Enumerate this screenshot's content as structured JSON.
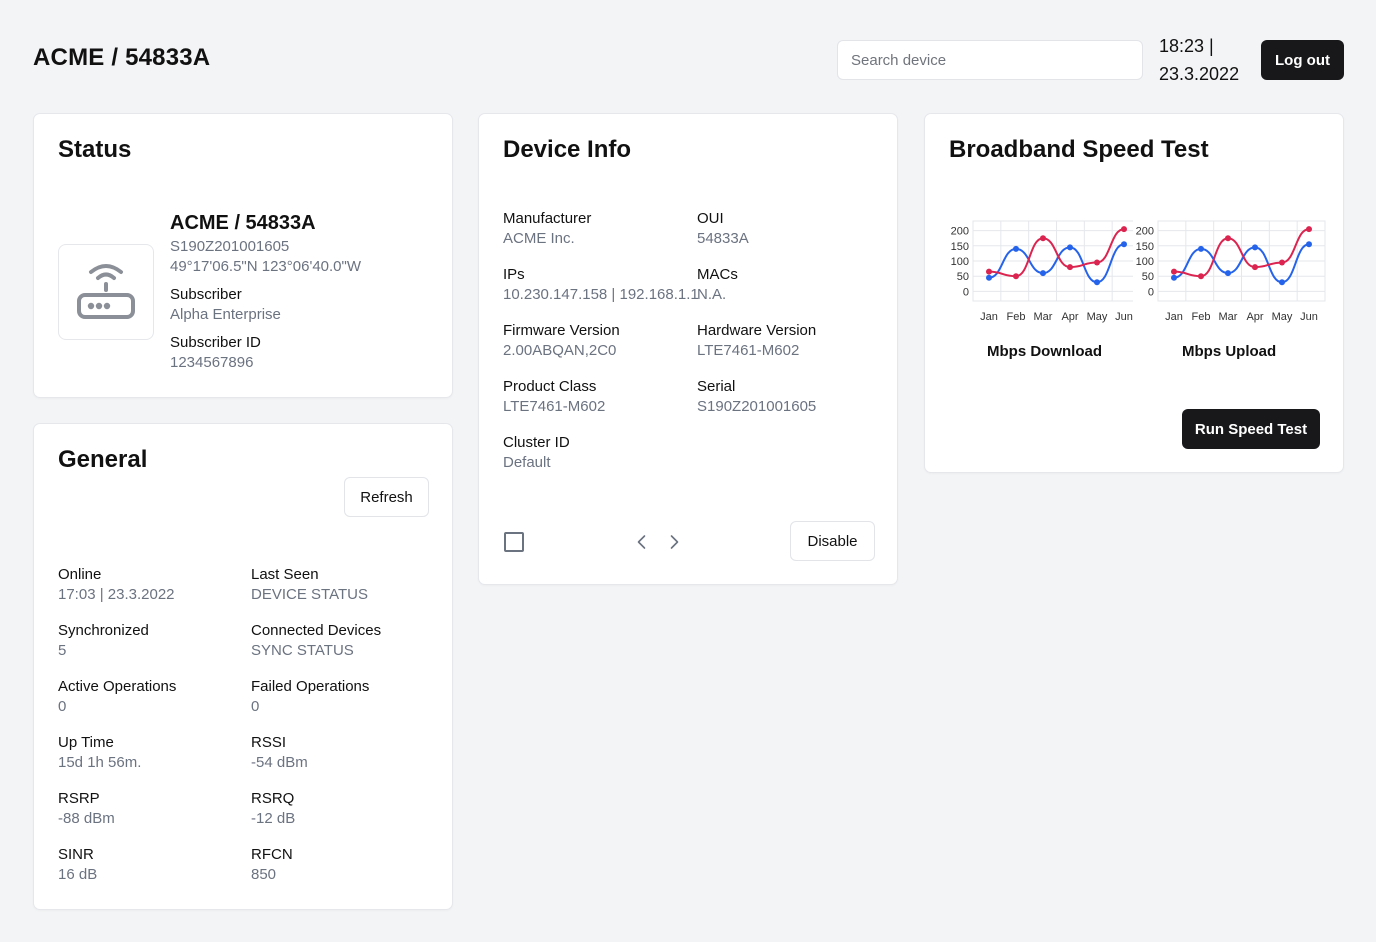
{
  "header": {
    "title": "ACME / 54833A",
    "search_placeholder": "Search device",
    "time": "18:23 |",
    "date": "23.3.2022",
    "logout_label": "Log out"
  },
  "status": {
    "title": "Status",
    "device_name": "ACME / 54833A",
    "serial": "S190Z201001605",
    "coordinates": "49°17'06.5\"N 123°06'40.0\"W",
    "subscriber_label": "Subscriber",
    "subscriber_value": "Alpha Enterprise",
    "subscriber_id_label": "Subscriber ID",
    "subscriber_id_value": "1234567896",
    "icon": "router-icon"
  },
  "general": {
    "title": "General",
    "refresh_label": "Refresh",
    "fields": [
      {
        "label": "Online",
        "value": "17:03 | 23.3.2022"
      },
      {
        "label": "Last Seen",
        "value": "DEVICE STATUS"
      },
      {
        "label": "Synchronized",
        "value": "5"
      },
      {
        "label": "Connected Devices",
        "value": "SYNC STATUS"
      },
      {
        "label": "Active Operations",
        "value": "0"
      },
      {
        "label": "Failed Operations",
        "value": "0"
      },
      {
        "label": "Up Time",
        "value": "15d 1h 56m."
      },
      {
        "label": "RSSI",
        "value": "-54 dBm"
      },
      {
        "label": "RSRP",
        "value": "-88 dBm"
      },
      {
        "label": "RSRQ",
        "value": "-12 dB"
      },
      {
        "label": "SINR",
        "value": "16 dB"
      },
      {
        "label": "RFCN",
        "value": "850"
      }
    ]
  },
  "device_info": {
    "title": "Device Info",
    "fields": [
      {
        "label": "Manufacturer",
        "value": "ACME Inc."
      },
      {
        "label": "OUI",
        "value": "54833A"
      },
      {
        "label": "IPs",
        "value": "10.230.147.158 | 192.168.1.1"
      },
      {
        "label": "MACs",
        "value": "N.A."
      },
      {
        "label": "Firmware Version",
        "value": "2.00ABQAN,2C0"
      },
      {
        "label": "Hardware Version",
        "value": "LTE7461-M602"
      },
      {
        "label": "Product Class",
        "value": "LTE7461-M602"
      },
      {
        "label": "Serial",
        "value": "S190Z201001605"
      },
      {
        "label": "Cluster ID",
        "value": "Default"
      }
    ],
    "disable_label": "Disable"
  },
  "speed_test": {
    "title": "Broadband Speed Test",
    "run_label": "Run Speed Test",
    "colors": {
      "blue": "#2563eb",
      "red": "#dc2450",
      "grid": "#e5e7eb"
    }
  },
  "chart_data": [
    {
      "type": "line",
      "title": "Mbps Download",
      "categories": [
        "Jan",
        "Feb",
        "Mar",
        "Apr",
        "May",
        "Jun"
      ],
      "yticks": [
        "200",
        "150",
        "100",
        "50",
        "0"
      ],
      "ylim": [
        0,
        200
      ],
      "grid": true,
      "series": [
        {
          "color": "#2563eb",
          "values": [
            45,
            140,
            60,
            145,
            30,
            155
          ]
        },
        {
          "color": "#dc2450",
          "values": [
            65,
            50,
            175,
            80,
            95,
            205
          ]
        }
      ]
    },
    {
      "type": "line",
      "title": "Mbps Upload",
      "categories": [
        "Jan",
        "Feb",
        "Mar",
        "Apr",
        "May",
        "Jun"
      ],
      "yticks": [
        "200",
        "150",
        "100",
        "50",
        "0"
      ],
      "ylim": [
        0,
        200
      ],
      "grid": true,
      "series": [
        {
          "color": "#2563eb",
          "values": [
            45,
            140,
            60,
            145,
            30,
            155
          ]
        },
        {
          "color": "#dc2450",
          "values": [
            65,
            50,
            175,
            80,
            95,
            205
          ]
        }
      ]
    }
  ]
}
